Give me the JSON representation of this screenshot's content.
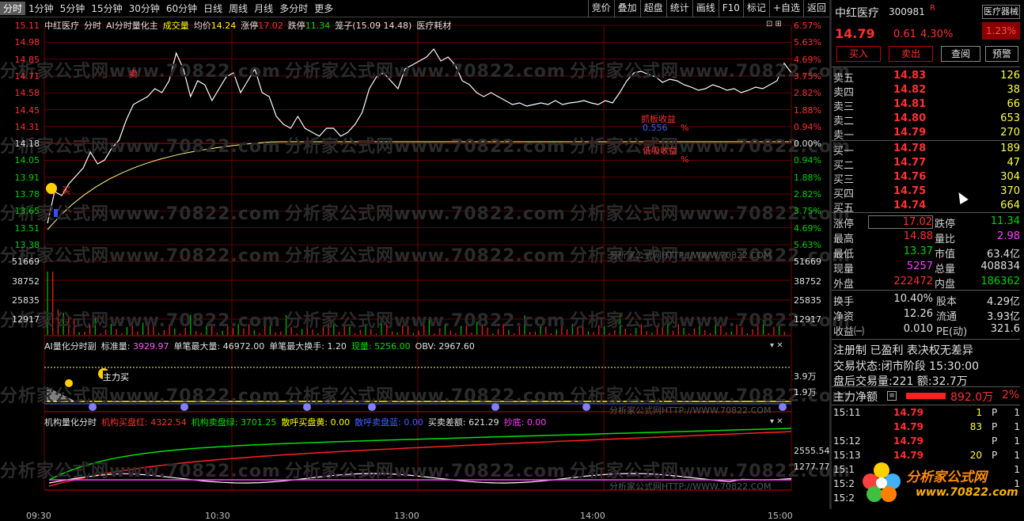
{
  "toolbar": {
    "periods": [
      "分时",
      "1分钟",
      "5分钟",
      "15分钟",
      "30分钟",
      "60分钟",
      "日线",
      "周线",
      "月线",
      "多分时",
      "更多"
    ],
    "tools": [
      "竞价",
      "叠加",
      "超盘",
      "统计",
      "画线",
      "F10",
      "标记",
      "+自选",
      "返回"
    ]
  },
  "main_chart": {
    "title": "中红医疗",
    "mode": "分时",
    "indicator": "AI分时量化主",
    "vol_label": "成交量",
    "avg_label": "均价",
    "avg": "14.24",
    "up_label": "涨停",
    "up": "17.02",
    "down_label": "跌停",
    "down": "11.34",
    "cage_label": "笼子",
    "cage": "(15.09 14.48)",
    "sector": "医疗耗材",
    "price_ticks": [
      "15.11",
      "14.98",
      "14.85",
      "14.71",
      "14.58",
      "14.45",
      "14.31",
      "14.18",
      "14.05",
      "13.91",
      "13.78",
      "13.65",
      "13.51",
      "13.38"
    ],
    "pct_ticks": [
      "6.57%",
      "5.63%",
      "4.69%",
      "3.75%",
      "2.82%",
      "1.88%",
      "0.94%",
      "0.00%",
      "0.94%",
      "1.88%",
      "2.82%",
      "3.75%",
      "4.69%",
      "5.63%",
      "6.57%"
    ],
    "vol_ticks": [
      "51669",
      "38752",
      "25835",
      "12917"
    ],
    "annotations": {
      "grab_label": "抓板收益",
      "grab_value": "0.556",
      "pct": "%",
      "low_label": "低吸收益",
      "buy_mark": "买",
      "sell_mark": "卖"
    }
  },
  "colors": {
    "red": "#ff3030",
    "green": "#00e000",
    "yellow": "#ffff00",
    "gray_bg": "#000000",
    "grid": "#8b0000"
  },
  "sub1": {
    "title": "AI量化分时副",
    "std_label": "标准量:",
    "std": "3929.97",
    "max_label": "单笔最大量:",
    "max": "46972.00",
    "turn_label": "单笔最大换手:",
    "turn": "1.20",
    "now_label": "现量:",
    "now": "5256.00",
    "obv_label": "OBV:",
    "obv": "2967.60",
    "y1": "3.9万",
    "y2": "1.9万",
    "badge": "主力买"
  },
  "sub2": {
    "title": "机构量化分时",
    "red_label": "机构买盘红:",
    "red": "4322.54",
    "green_label": "机构卖盘绿:",
    "green": "3701.25",
    "yb_label": "散呼买盘黄:",
    "yb": "0.00",
    "bs_label": "散呼卖盘蓝:",
    "bs": "0.00",
    "diff_label": "买卖差额:",
    "diff": "621.29",
    "bottom_label": "抄底:",
    "bottom": "0.00",
    "y1": "2555.54",
    "y2": "1277.77"
  },
  "times": [
    "09:30",
    "10:30",
    "13:00",
    "14:00",
    "15:00"
  ],
  "watermark": "分析家公式网www.70822.com",
  "watermark_small": "分析家公式网HTTP://WWW.70822.COM",
  "quote": {
    "name": "中红医疗",
    "code": "300981",
    "code_flag": "R",
    "sector_badge": "医疗器械",
    "sector_pct": "1.23%",
    "price": "14.79",
    "change": "0.61",
    "pct": "4.30%",
    "buttons": [
      "买入",
      "卖出",
      "查阅",
      "预警"
    ],
    "sells": [
      {
        "l": "卖五",
        "p": "14.83",
        "v": "126"
      },
      {
        "l": "卖四",
        "p": "14.82",
        "v": "38"
      },
      {
        "l": "卖三",
        "p": "14.81",
        "v": "66"
      },
      {
        "l": "卖二",
        "p": "14.80",
        "v": "653"
      },
      {
        "l": "卖一",
        "p": "14.79",
        "v": "270"
      }
    ],
    "buys": [
      {
        "l": "买一",
        "p": "14.78",
        "v": "189"
      },
      {
        "l": "买二",
        "p": "14.77",
        "v": "47"
      },
      {
        "l": "买三",
        "p": "14.76",
        "v": "304"
      },
      {
        "l": "买四",
        "p": "14.75",
        "v": "370"
      },
      {
        "l": "买五",
        "p": "14.74",
        "v": "664"
      }
    ],
    "stats": [
      {
        "l1": "涨停",
        "v1": "17.02",
        "l2": "跌停",
        "v2": "11.34"
      },
      {
        "l1": "最高",
        "v1": "14.88",
        "l2": "量比",
        "v2": "2.98"
      },
      {
        "l1": "最低",
        "v1": "13.37",
        "l2": "市值",
        "v2": "63.4亿"
      },
      {
        "l1": "现量",
        "v1": "5257",
        "l2": "总量",
        "v2": "408834"
      },
      {
        "l1": "外盘",
        "v1": "222472",
        "l2": "内盘",
        "v2": "186362"
      }
    ],
    "stats2": [
      {
        "l1": "换手",
        "v1": "10.40%",
        "l2": "股本",
        "v2": "4.29亿"
      },
      {
        "l1": "净资",
        "v1": "12.26",
        "l2": "流通",
        "v2": "3.93亿"
      },
      {
        "l1": "收益㈠",
        "v1": "0.010",
        "l2": "PE(动)",
        "v2": "321.6"
      }
    ],
    "reg": "注册制 已盈利 表决权无差异",
    "status_label": "交易状态:",
    "status": "闭市阶段",
    "status_time": "15:30:00",
    "after_label": "盘后交易量:",
    "after_vol": "221",
    "amt_label": "额:",
    "amt": "32.7万",
    "main_label": "主力净额",
    "main_val": "892.0万",
    "main_pct": "2%",
    "ticks": [
      {
        "t": "15:11",
        "p": "14.79",
        "v": "1",
        "f": "P",
        "n": "1"
      },
      {
        "t": "",
        "p": "14.79",
        "v": "83",
        "f": "P",
        "n": "1"
      },
      {
        "t": "15:12",
        "p": "14.79",
        "v": "",
        "f": "P",
        "n": "1"
      },
      {
        "t": "15:13",
        "p": "14.79",
        "v": "20",
        "f": "P",
        "n": "1"
      },
      {
        "t": "15:1",
        "p": "",
        "v": "",
        "f": "",
        "n": "1"
      },
      {
        "t": "15:2",
        "p": "",
        "v": "",
        "f": "",
        "n": "1"
      },
      {
        "t": "15:2",
        "p": "",
        "v": "",
        "f": "",
        "n": ""
      }
    ],
    "logo_text": "分析家公式网",
    "logo_url": "www.70822.com"
  }
}
